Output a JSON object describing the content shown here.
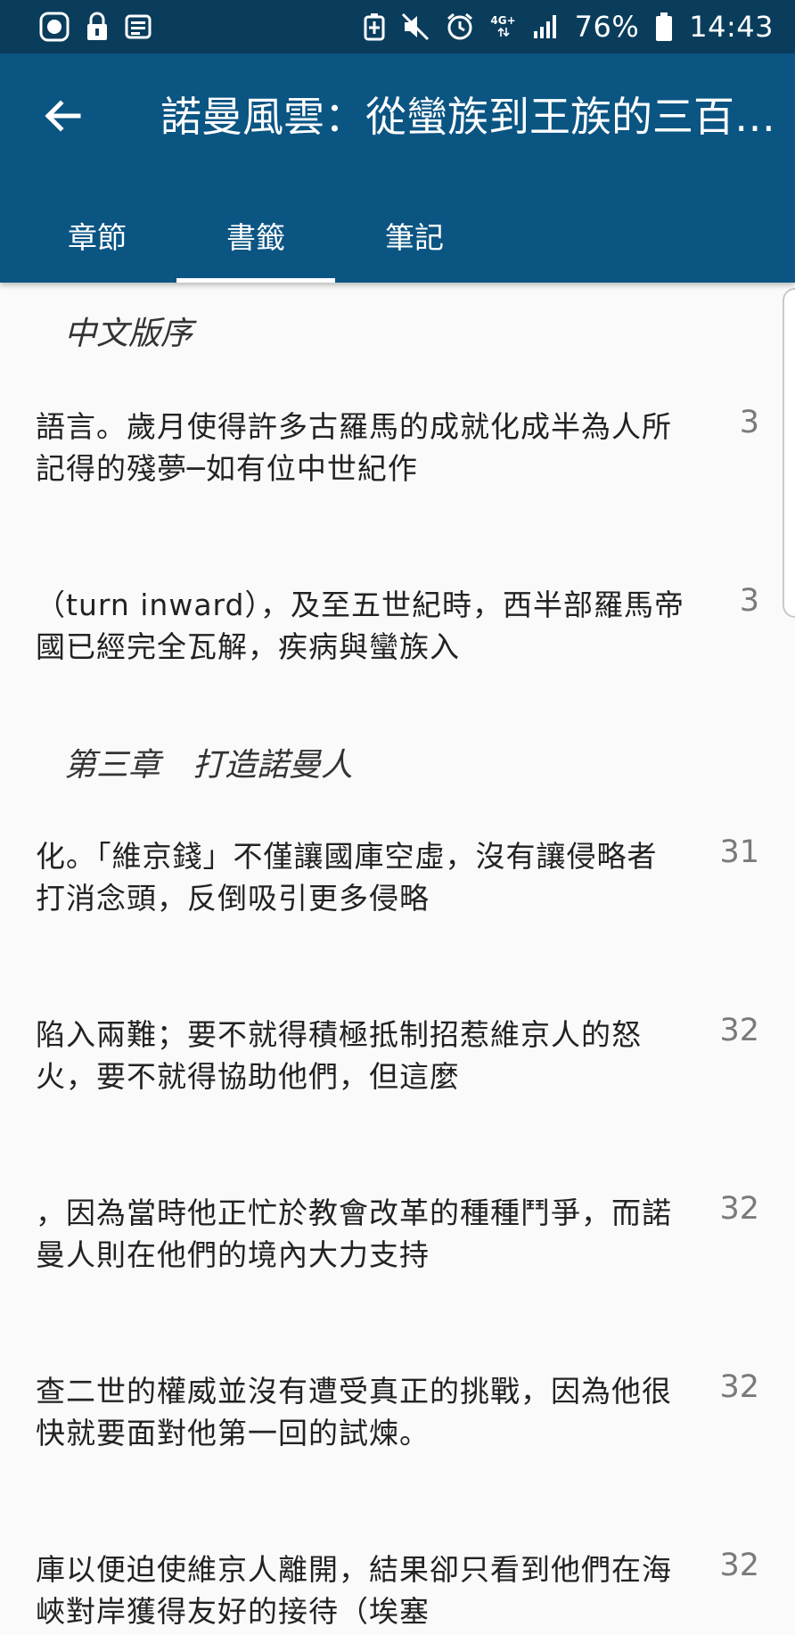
{
  "status_bar": {
    "network": "4G+",
    "battery": "76%",
    "time": "14:43"
  },
  "header": {
    "title": "諾曼風雲：從蠻族到王族的三百…",
    "back_icon": "arrow-left-icon"
  },
  "tabs": [
    {
      "label": "章節",
      "active": false
    },
    {
      "label": "書籤",
      "active": true
    },
    {
      "label": "筆記",
      "active": false
    }
  ],
  "sections": [
    {
      "title": "中文版序"
    },
    {
      "title": "第三章　打造諾曼人"
    }
  ],
  "bookmarks": [
    {
      "text": "語言。歲月使得許多古羅馬的成就化成半為人所記得的殘夢─如有位中世紀作",
      "page": "3"
    },
    {
      "text": "（turn inward），及至五世紀時，西半部羅馬帝國已經完全瓦解，疾病與蠻族入",
      "page": "3"
    },
    {
      "text": "化。「維京錢」不僅讓國庫空虛，沒有讓侵略者打消念頭，反倒吸引更多侵略",
      "page": "31"
    },
    {
      "text": "陷入兩難；要不就得積極抵制招惹維京人的怒火，要不就得協助他們，但這麼",
      "page": "32"
    },
    {
      "text": "，因為當時他正忙於教會改革的種種鬥爭，而諾曼人則在他們的境內大力支持",
      "page": "32"
    },
    {
      "text": "查二世的權威並沒有遭受真正的挑戰，因為他很快就要面對他第一回的試煉。",
      "page": "32"
    },
    {
      "text": "庫以便迫使維京人離開，結果卻只看到他們在海峽對岸獲得友好的接待（埃塞",
      "page": "32"
    }
  ],
  "colors": {
    "status_bar": "#0a3d5c",
    "app_bar": "#0b5583",
    "background": "#fafafa",
    "text": "#222222",
    "page_number": "#7a7a7a"
  }
}
